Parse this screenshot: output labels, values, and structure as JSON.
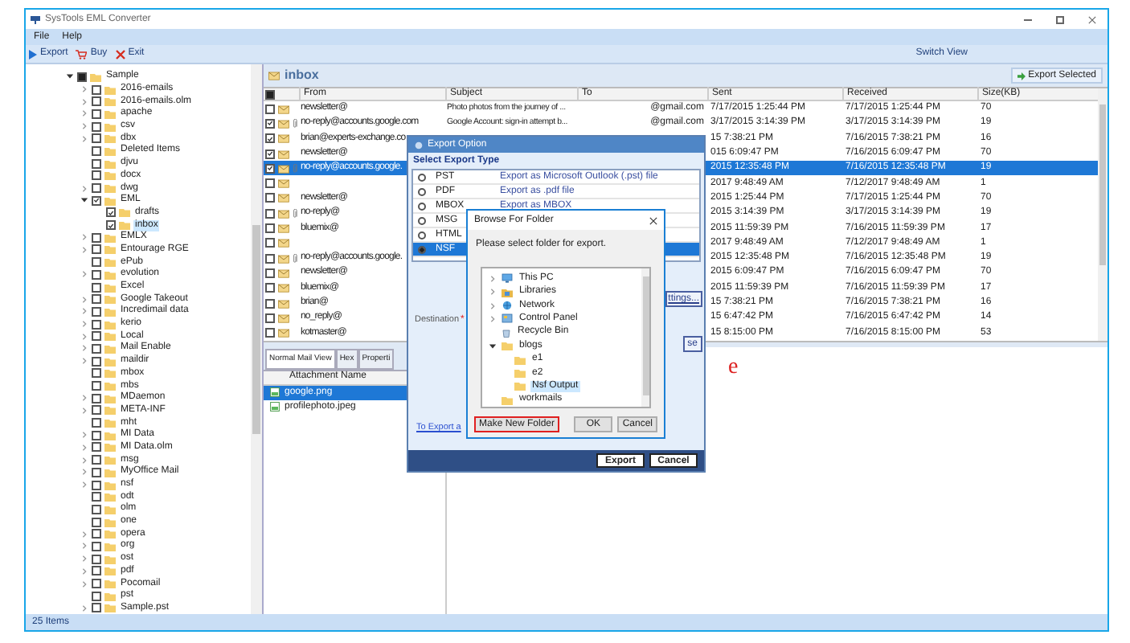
{
  "window": {
    "title": "SysTools EML Converter"
  },
  "menu": [
    "File",
    "Help"
  ],
  "toolbar": [
    {
      "kind": "export",
      "label": "Export"
    },
    {
      "kind": "buy",
      "label": "Buy"
    },
    {
      "kind": "exit",
      "label": "Exit"
    }
  ],
  "switch_view": "Switch View",
  "folder_tree": [
    {
      "label": "Sample",
      "expandable": true,
      "checked": false,
      "partial": true,
      "selected": false,
      "children": [
        {
          "label": "2016-emails",
          "expandable": true,
          "checked": false,
          "partial": false,
          "selected": false
        },
        {
          "label": "2016-emails.olm",
          "expandable": true,
          "checked": false,
          "partial": false,
          "selected": false
        },
        {
          "label": "apache",
          "expandable": true,
          "checked": false,
          "partial": false,
          "selected": false
        },
        {
          "label": "csv",
          "expandable": true,
          "checked": false,
          "partial": false,
          "selected": false
        },
        {
          "label": "dbx",
          "expandable": true,
          "checked": false,
          "partial": false,
          "selected": false
        },
        {
          "label": "Deleted Items",
          "expandable": false,
          "checked": false,
          "partial": false,
          "selected": false
        },
        {
          "label": "djvu",
          "expandable": false,
          "checked": false,
          "partial": false,
          "selected": false
        },
        {
          "label": "docx",
          "expandable": false,
          "checked": false,
          "partial": false,
          "selected": false
        },
        {
          "label": "dwg",
          "expandable": true,
          "checked": false,
          "partial": false,
          "selected": false
        },
        {
          "label": "EML",
          "expandable": true,
          "checked": true,
          "partial": false,
          "selected": false,
          "children": [
            {
              "label": "drafts",
              "expandable": false,
              "checked": true,
              "partial": false,
              "selected": false
            },
            {
              "label": "inbox",
              "expandable": false,
              "checked": true,
              "partial": false,
              "selected": true
            }
          ]
        },
        {
          "label": "EMLX",
          "expandable": true,
          "checked": false,
          "partial": false,
          "selected": false
        },
        {
          "label": "Entourage RGE",
          "expandable": true,
          "checked": false,
          "partial": false,
          "selected": false
        },
        {
          "label": "ePub",
          "expandable": false,
          "checked": false,
          "partial": false,
          "selected": false
        },
        {
          "label": "evolution",
          "expandable": true,
          "checked": false,
          "partial": false,
          "selected": false
        },
        {
          "label": "Excel",
          "expandable": false,
          "checked": false,
          "partial": false,
          "selected": false
        },
        {
          "label": "Google Takeout",
          "expandable": true,
          "checked": false,
          "partial": false,
          "selected": false
        },
        {
          "label": "Incredimail data",
          "expandable": true,
          "checked": false,
          "partial": false,
          "selected": false
        },
        {
          "label": "kerio",
          "expandable": true,
          "checked": false,
          "partial": false,
          "selected": false
        },
        {
          "label": "Local",
          "expandable": true,
          "checked": false,
          "partial": false,
          "selected": false
        },
        {
          "label": "Mail Enable",
          "expandable": true,
          "checked": false,
          "partial": false,
          "selected": false
        },
        {
          "label": "maildir",
          "expandable": true,
          "checked": false,
          "partial": false,
          "selected": false
        },
        {
          "label": "mbox",
          "expandable": false,
          "checked": false,
          "partial": false,
          "selected": false
        },
        {
          "label": "mbs",
          "expandable": false,
          "checked": false,
          "partial": false,
          "selected": false
        },
        {
          "label": "MDaemon",
          "expandable": true,
          "checked": false,
          "partial": false,
          "selected": false
        },
        {
          "label": "META-INF",
          "expandable": true,
          "checked": false,
          "partial": false,
          "selected": false
        },
        {
          "label": "mht",
          "expandable": false,
          "checked": false,
          "partial": false,
          "selected": false
        },
        {
          "label": "MI Data",
          "expandable": true,
          "checked": false,
          "partial": false,
          "selected": false
        },
        {
          "label": "MI Data.olm",
          "expandable": true,
          "checked": false,
          "partial": false,
          "selected": false
        },
        {
          "label": "msg",
          "expandable": true,
          "checked": false,
          "partial": false,
          "selected": false
        },
        {
          "label": "MyOffice Mail",
          "expandable": true,
          "checked": false,
          "partial": false,
          "selected": false
        },
        {
          "label": "nsf",
          "expandable": true,
          "checked": false,
          "partial": false,
          "selected": false
        },
        {
          "label": "odt",
          "expandable": false,
          "checked": false,
          "partial": false,
          "selected": false
        },
        {
          "label": "olm",
          "expandable": false,
          "checked": false,
          "partial": false,
          "selected": false
        },
        {
          "label": "one",
          "expandable": false,
          "checked": false,
          "partial": false,
          "selected": false
        },
        {
          "label": "opera",
          "expandable": true,
          "checked": false,
          "partial": false,
          "selected": false
        },
        {
          "label": "org",
          "expandable": true,
          "checked": false,
          "partial": false,
          "selected": false
        },
        {
          "label": "ost",
          "expandable": true,
          "checked": false,
          "partial": false,
          "selected": false
        },
        {
          "label": "pdf",
          "expandable": true,
          "checked": false,
          "partial": false,
          "selected": false
        },
        {
          "label": "Pocomail",
          "expandable": true,
          "checked": false,
          "partial": false,
          "selected": false
        },
        {
          "label": "pst",
          "expandable": false,
          "checked": false,
          "partial": false,
          "selected": false
        },
        {
          "label": "Sample.pst",
          "expandable": true,
          "checked": false,
          "partial": false,
          "selected": false
        }
      ]
    }
  ],
  "mail_panel": {
    "title": "inbox",
    "export_selected": "Export Selected",
    "select_all": {
      "checked": false,
      "partial": true
    },
    "columns": [
      "From",
      "Subject",
      "To",
      "Sent",
      "Received",
      "Size(KB)"
    ],
    "rows": [
      {
        "checked": false,
        "selected": false,
        "attachment": false,
        "from": "newsletter@",
        "subject": "Photo photos from the journey of ...",
        "to": "@gmail.com",
        "sent": "7/17/2015 1:25:44 PM",
        "received": "7/17/2015 1:25:44 PM",
        "size": "70"
      },
      {
        "checked": true,
        "selected": false,
        "attachment": true,
        "from": "no-reply@accounts.google.com",
        "subject": "Google Account: sign-in attempt b...",
        "to": "@gmail.com",
        "sent": "3/17/2015 3:14:39 PM",
        "received": "3/17/2015 3:14:39 PM",
        "size": "19"
      },
      {
        "checked": true,
        "selected": false,
        "attachment": false,
        "from": "brian@experts-exchange.co",
        "sent": "15 7:38:21 PM",
        "received": "7/16/2015 7:38:21 PM",
        "size": "16"
      },
      {
        "checked": true,
        "selected": false,
        "attachment": false,
        "from": "newsletter@",
        "sent": "015 6:09:47 PM",
        "received": "7/16/2015 6:09:47 PM",
        "size": "70"
      },
      {
        "checked": true,
        "selected": true,
        "attachment": true,
        "from": "no-reply@accounts.google.",
        "sent": "2015 12:35:48 PM",
        "received": "7/16/2015 12:35:48 PM",
        "size": "19"
      },
      {
        "checked": false,
        "selected": false,
        "attachment": false,
        "sent": "2017 9:48:49 AM",
        "received": "7/12/2017 9:48:49 AM",
        "size": "1"
      },
      {
        "checked": false,
        "selected": false,
        "attachment": false,
        "from": "newsletter@",
        "sent": "2015 1:25:44 PM",
        "received": "7/17/2015 1:25:44 PM",
        "size": "70"
      },
      {
        "checked": false,
        "selected": false,
        "attachment": true,
        "from": "no-reply@",
        "sent": "2015 3:14:39 PM",
        "received": "3/17/2015 3:14:39 PM",
        "size": "19"
      },
      {
        "checked": false,
        "selected": false,
        "attachment": false,
        "from": "bluemix@",
        "sent": "2015 11:59:39 PM",
        "received": "7/16/2015 11:59:39 PM",
        "size": "17"
      },
      {
        "checked": false,
        "selected": false,
        "attachment": false,
        "sent": "2017 9:48:49 AM",
        "received": "7/12/2017 9:48:49 AM",
        "size": "1"
      },
      {
        "checked": false,
        "selected": false,
        "attachment": true,
        "from": "no-reply@accounts.google.",
        "sent": "2015 12:35:48 PM",
        "received": "7/16/2015 12:35:48 PM",
        "size": "19"
      },
      {
        "checked": false,
        "selected": false,
        "attachment": false,
        "from": "newsletter@",
        "sent": "2015 6:09:47 PM",
        "received": "7/16/2015 6:09:47 PM",
        "size": "70"
      },
      {
        "checked": false,
        "selected": false,
        "attachment": false,
        "from": "bluemix@",
        "sent": "2015 11:59:39 PM",
        "received": "7/16/2015 11:59:39 PM",
        "size": "17"
      },
      {
        "checked": false,
        "selected": false,
        "attachment": false,
        "from": "brian@",
        "sent": "15 7:38:21 PM",
        "received": "7/16/2015 7:38:21 PM",
        "size": "16"
      },
      {
        "checked": false,
        "selected": false,
        "attachment": false,
        "from": "no_reply@",
        "sent": "15 6:47:42 PM",
        "received": "7/16/2015 6:47:42 PM",
        "size": "14"
      },
      {
        "checked": false,
        "selected": false,
        "attachment": false,
        "from": "kotmaster@",
        "sent": "15 8:15:00 PM",
        "received": "7/16/2015 8:15:00 PM",
        "size": "53"
      }
    ]
  },
  "view_tabs": [
    {
      "label": "Normal Mail View",
      "selected": true
    },
    {
      "label": "Hex",
      "selected": false
    },
    {
      "label": "Properti",
      "selected": false
    }
  ],
  "attachments": {
    "column": "Attachment Name",
    "rows": [
      {
        "name": "google.png",
        "selected": true
      },
      {
        "name": "profilephoto.jpeg",
        "selected": false
      }
    ]
  },
  "preview": {
    "mark": "e"
  },
  "export_dialog": {
    "title": "Export Option",
    "section": "Select Export Type",
    "options": [
      {
        "label": "PST",
        "description": "Export as Microsoft Outlook (.pst) file",
        "selected": false
      },
      {
        "label": "PDF",
        "description": "Export as .pdf file",
        "selected": false
      },
      {
        "label": "MBOX",
        "description": "Export as MBOX",
        "selected": false
      },
      {
        "label": "MSG",
        "selected": false
      },
      {
        "label": "HTML",
        "selected": false
      },
      {
        "label": "NSF",
        "selected": true
      }
    ],
    "settings_button": "ttings...",
    "destination_label": "Destination",
    "required_mark": "*",
    "browse_button": "se",
    "link": "To Export a",
    "buttons": [
      "Export",
      "Cancel"
    ]
  },
  "browse_dialog": {
    "title": "Browse For Folder",
    "prompt": "Please select folder for export.",
    "tree": [
      {
        "label": "This PC",
        "kind": "pc",
        "expandable": true,
        "selected": false
      },
      {
        "label": "Libraries",
        "kind": "library",
        "expandable": true,
        "selected": false
      },
      {
        "label": "Network",
        "kind": "network",
        "expandable": true,
        "selected": false
      },
      {
        "label": "Control Panel",
        "kind": "control",
        "expandable": true,
        "selected": false
      },
      {
        "label": "Recycle Bin",
        "kind": "recycle",
        "expandable": false,
        "selected": false
      },
      {
        "label": "blogs",
        "kind": "folder",
        "expandable": true,
        "selected": false,
        "children": [
          {
            "label": "e1",
            "kind": "folder",
            "expandable": false,
            "selected": false
          },
          {
            "label": "e2",
            "kind": "folder",
            "expandable": false,
            "selected": false
          },
          {
            "label": "Nsf Output",
            "kind": "folder",
            "expandable": false,
            "selected": true
          }
        ]
      },
      {
        "label": "workmails",
        "kind": "folder",
        "expandable": false,
        "selected": false
      }
    ],
    "buttons": [
      "Make New Folder",
      "OK",
      "Cancel"
    ]
  },
  "status_bar": "25 Items"
}
